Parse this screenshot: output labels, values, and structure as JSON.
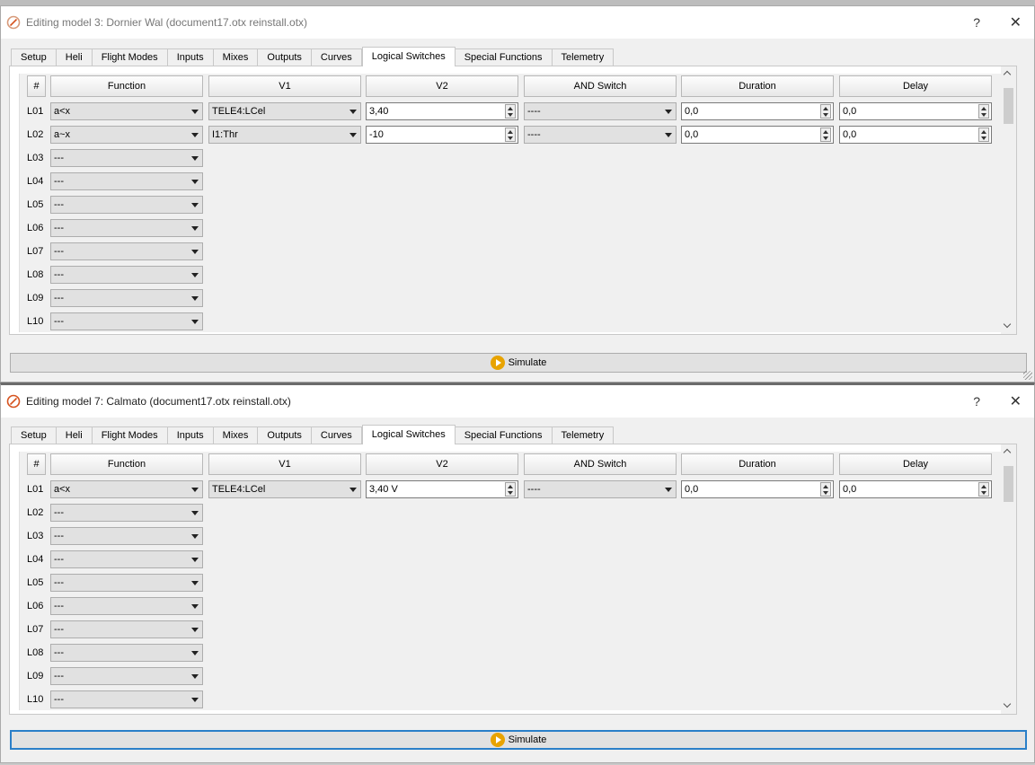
{
  "windows": [
    {
      "title": "Editing model 3: Dornier Wal  (document17.otx reinstall.otx)",
      "help": "?",
      "close": "✕",
      "tabs": [
        "Setup",
        "Heli",
        "Flight Modes",
        "Inputs",
        "Mixes",
        "Outputs",
        "Curves",
        "Logical Switches",
        "Special Functions",
        "Telemetry"
      ],
      "active_tab": "Logical Switches",
      "headers": {
        "num": "#",
        "function": "Function",
        "v1": "V1",
        "v2": "V2",
        "and_switch": "AND Switch",
        "duration": "Duration",
        "delay": "Delay"
      },
      "rows": [
        {
          "label": "L01",
          "function": "a<x",
          "v1": "TELE4:LCel",
          "v2": "3,40",
          "and_switch": "----",
          "duration": "0,0",
          "delay": "0,0"
        },
        {
          "label": "L02",
          "function": "a~x",
          "v1": "I1:Thr",
          "v2": "-10",
          "and_switch": "----",
          "duration": "0,0",
          "delay": "0,0"
        },
        {
          "label": "L03",
          "function": "---"
        },
        {
          "label": "L04",
          "function": "---"
        },
        {
          "label": "L05",
          "function": "---"
        },
        {
          "label": "L06",
          "function": "---"
        },
        {
          "label": "L07",
          "function": "---"
        },
        {
          "label": "L08",
          "function": "---"
        },
        {
          "label": "L09",
          "function": "---"
        },
        {
          "label": "L10",
          "function": "---"
        }
      ],
      "simulate": "Simulate"
    },
    {
      "title": "Editing model 7: Calmato  (document17.otx reinstall.otx)",
      "help": "?",
      "close": "✕",
      "tabs": [
        "Setup",
        "Heli",
        "Flight Modes",
        "Inputs",
        "Mixes",
        "Outputs",
        "Curves",
        "Logical Switches",
        "Special Functions",
        "Telemetry"
      ],
      "active_tab": "Logical Switches",
      "headers": {
        "num": "#",
        "function": "Function",
        "v1": "V1",
        "v2": "V2",
        "and_switch": "AND Switch",
        "duration": "Duration",
        "delay": "Delay"
      },
      "rows": [
        {
          "label": "L01",
          "function": "a<x",
          "v1": "TELE4:LCel",
          "v2": "3,40 V",
          "and_switch": "----",
          "duration": "0,0",
          "delay": "0,0"
        },
        {
          "label": "L02",
          "function": "---"
        },
        {
          "label": "L03",
          "function": "---"
        },
        {
          "label": "L04",
          "function": "---"
        },
        {
          "label": "L05",
          "function": "---"
        },
        {
          "label": "L06",
          "function": "---"
        },
        {
          "label": "L07",
          "function": "---"
        },
        {
          "label": "L08",
          "function": "---"
        },
        {
          "label": "L09",
          "function": "---"
        },
        {
          "label": "L10",
          "function": "---"
        }
      ],
      "simulate": "Simulate"
    }
  ]
}
